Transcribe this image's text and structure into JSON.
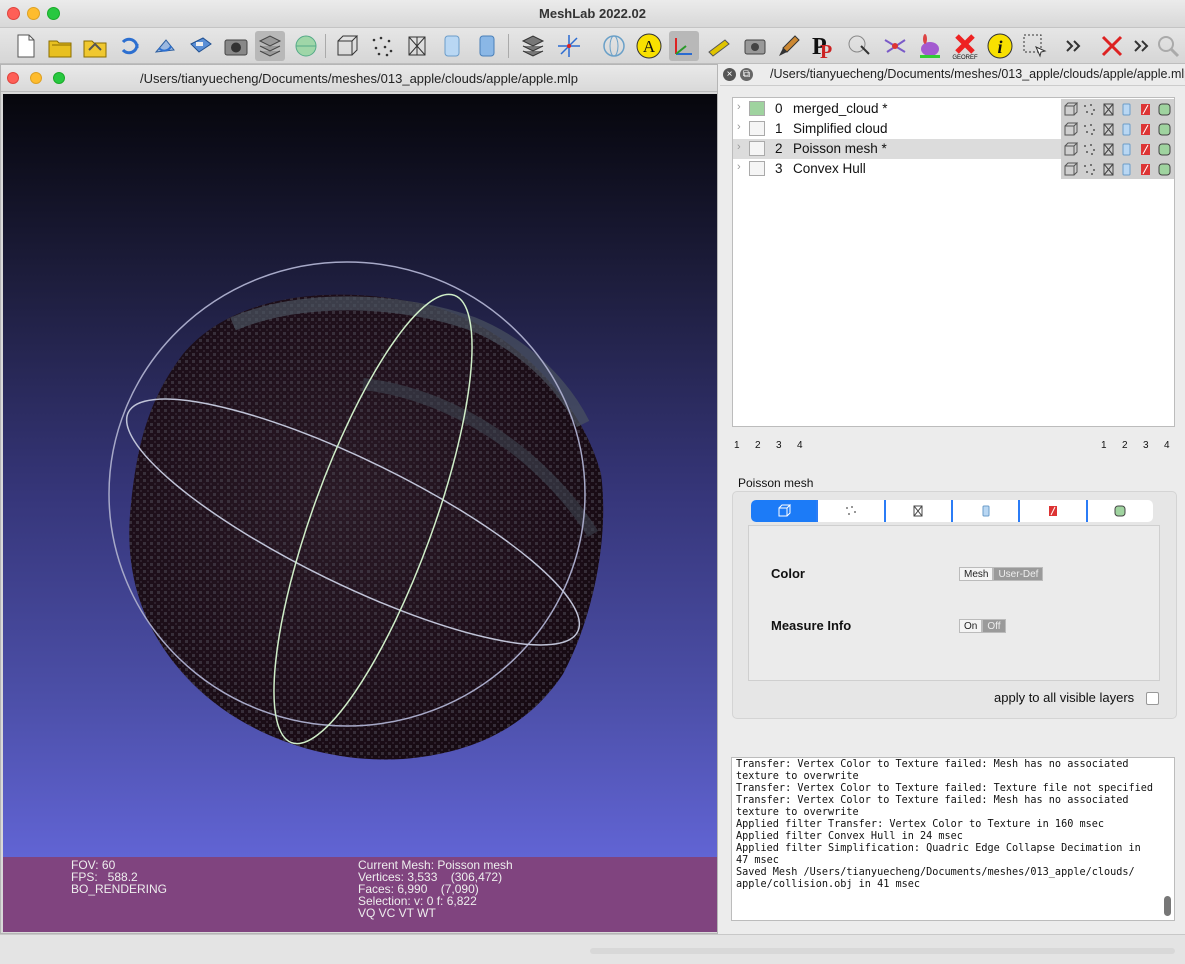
{
  "app": {
    "title": "MeshLab 2022.02"
  },
  "subwindow": {
    "path": "/Users/tianyuecheng/Documents/meshes/013_apple/clouds/apple/apple.mlp"
  },
  "toolbar": {
    "icons": [
      "new-project-icon",
      "open-project-icon",
      "import-mesh-icon",
      "reload-icon",
      "reload-all-icon",
      "save-icon",
      "snapshot-icon",
      "layers-icon",
      "raster-icon",
      "bounding-box-icon",
      "points-icon",
      "wireframe-icon",
      "flat-icon",
      "smooth-icon",
      "texture-icon",
      "trackball-icon",
      "axes-icon",
      "globe-icon",
      "annotate-icon",
      "measure-icon",
      "paint-icon",
      "raster-alignment-icon",
      "pickpoints-icon",
      "align-icon",
      "info-icon",
      "select-icon",
      "more-icon",
      "delete-icon",
      "search-icon"
    ]
  },
  "viewport": {
    "info_left": [
      "FOV: 60",
      "FPS:   588.2",
      "BO_RENDERING"
    ],
    "info_right": [
      "Current Mesh: Poisson mesh",
      "Vertices: 3,533    (306,472)",
      "Faces: 6,990    (7,090)",
      "Selection: v: 0 f: 6,822",
      "VQ VC VT WT"
    ]
  },
  "panel": {
    "path": "/Users/tianyuecheng/Documents/meshes/013_apple/clouds/apple/apple.mlp",
    "layers": [
      {
        "num": "0",
        "name": "merged_cloud *",
        "selected": false,
        "visible": true
      },
      {
        "num": "1",
        "name": "Simplified cloud",
        "selected": false,
        "visible": false
      },
      {
        "num": "2",
        "name": "Poisson mesh *",
        "selected": true,
        "visible": false
      },
      {
        "num": "3",
        "name": "Convex Hull",
        "selected": false,
        "visible": false
      }
    ],
    "pager_left": [
      "1",
      "2",
      "3",
      "4"
    ],
    "pager_right": [
      "1",
      "2",
      "3",
      "4"
    ],
    "props_title": "Poisson mesh",
    "color_label": "Color",
    "color_options": [
      "Mesh",
      "User-Def"
    ],
    "measure_label": "Measure Info",
    "measure_options": [
      "On",
      "Off"
    ],
    "apply_label": "apply to all visible layers",
    "log": [
      "Transfer: Vertex Color to Texture failed: Mesh has no associated texture to overwrite",
      "Transfer: Vertex Color to Texture failed: Texture file not specified",
      "Transfer: Vertex Color to Texture failed: Mesh has no associated texture to overwrite",
      "Applied filter Transfer: Vertex Color to Texture in 160 msec",
      "Applied filter Convex Hull in 24 msec",
      "Applied filter Simplification: Quadric Edge Collapse Decimation in 47 msec",
      "Saved Mesh /Users/tianyuecheng/Documents/meshes/013_apple/clouds/ apple/collision.obj in 41 msec"
    ]
  },
  "colors": {
    "info_bar": "#80447f",
    "tab_active": "#1c7bf7",
    "viewport_bottom": "#6a6de0"
  }
}
